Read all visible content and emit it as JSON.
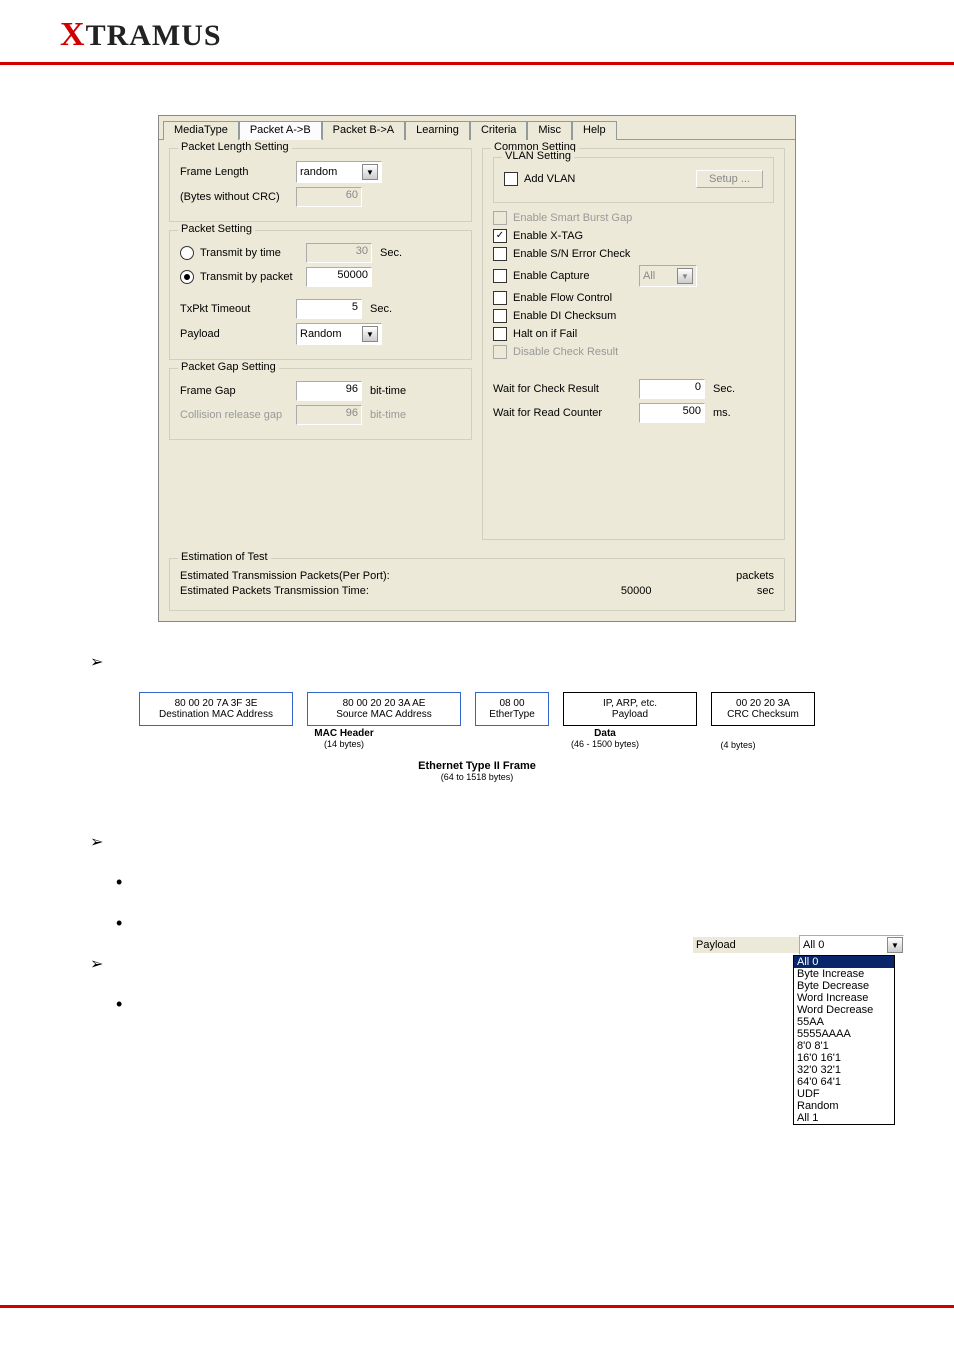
{
  "logo": {
    "x": "X",
    "rest": "TRAMUS"
  },
  "tabs": [
    "MediaType",
    "Packet A->B",
    "Packet B->A",
    "Learning",
    "Criteria",
    "Misc",
    "Help"
  ],
  "active_tab": "Packet A->B",
  "packet_length": {
    "group": "Packet Length Setting",
    "frame_length_label": "Frame Length",
    "frame_length_value": "random",
    "bytes_label": "(Bytes without CRC)",
    "bytes_value": "60"
  },
  "packet_setting": {
    "group": "Packet Setting",
    "transmit_time_label": "Transmit by time",
    "transmit_time_value": "30",
    "transmit_packet_label": "Transmit by packet",
    "transmit_packet_value": "50000",
    "sec": "Sec.",
    "txpkt_timeout_label": "TxPkt Timeout",
    "txpkt_timeout_value": "5",
    "payload_label": "Payload",
    "payload_value": "Random"
  },
  "packet_gap": {
    "group": "Packet Gap Setting",
    "frame_gap_label": "Frame Gap",
    "frame_gap_value": "96",
    "collision_label": "Collision release gap",
    "collision_value": "96",
    "bit_time": "bit-time"
  },
  "common": {
    "group": "Common Setting",
    "vlan_group": "VLAN Setting",
    "add_vlan": "Add VLAN",
    "setup": "Setup ...",
    "enable_smart_burst": "Enable Smart Burst Gap",
    "enable_xtag": "Enable X-TAG",
    "enable_sn_error": "Enable S/N Error Check",
    "enable_capture": "Enable Capture",
    "capture_opt": "All",
    "enable_flow": "Enable Flow Control",
    "enable_di": "Enable DI Checksum",
    "halt_on_fail": "Halt on if Fail",
    "disable_check": "Disable Check Result",
    "wait_check_label": "Wait for Check Result",
    "wait_check_value": "0",
    "wait_check_unit": "Sec.",
    "wait_read_label": "Wait for Read Counter",
    "wait_read_value": "500",
    "wait_read_unit": "ms."
  },
  "estimation": {
    "group": "Estimation of Test",
    "est_tx_label": "Estimated Transmission Packets(Per Port):",
    "est_tx_value": "",
    "packets": "packets",
    "est_time_label": "Estimated Packets Transmission Time:",
    "est_time_value": "50000",
    "sec": "sec"
  },
  "eth": {
    "dest_mac": "80 00 20 7A 3F 3E",
    "dest_mac_label": "Destination MAC Address",
    "src_mac": "80 00 20 20 3A AE",
    "src_mac_label": "Source MAC Address",
    "ethertype": "08 00",
    "ethertype_label": "EtherType",
    "payload": "IP, ARP, etc.",
    "payload_label": "Payload",
    "crc": "00 20 20 3A",
    "crc_label": "CRC Checksum",
    "mac_header_label": "MAC Header",
    "mac_header_sub": "(14 bytes)",
    "data_label": "Data",
    "data_sub": "(46 - 1500 bytes)",
    "crc_sub": "(4 bytes)",
    "frame_title": "Ethernet Type II Frame",
    "frame_sub": "(64 to 1518 bytes)"
  },
  "payload_fig": {
    "label": "Payload",
    "selected": "All 0",
    "items": [
      "All 0",
      "Byte Increase",
      "Byte Decrease",
      "Word Increase",
      "Word Decrease",
      "55AA",
      "5555AAAA",
      "8'0 8'1",
      "16'0 16'1",
      "32'0 32'1",
      "64'0 64'1",
      "UDF",
      "Random",
      "All 1"
    ]
  }
}
